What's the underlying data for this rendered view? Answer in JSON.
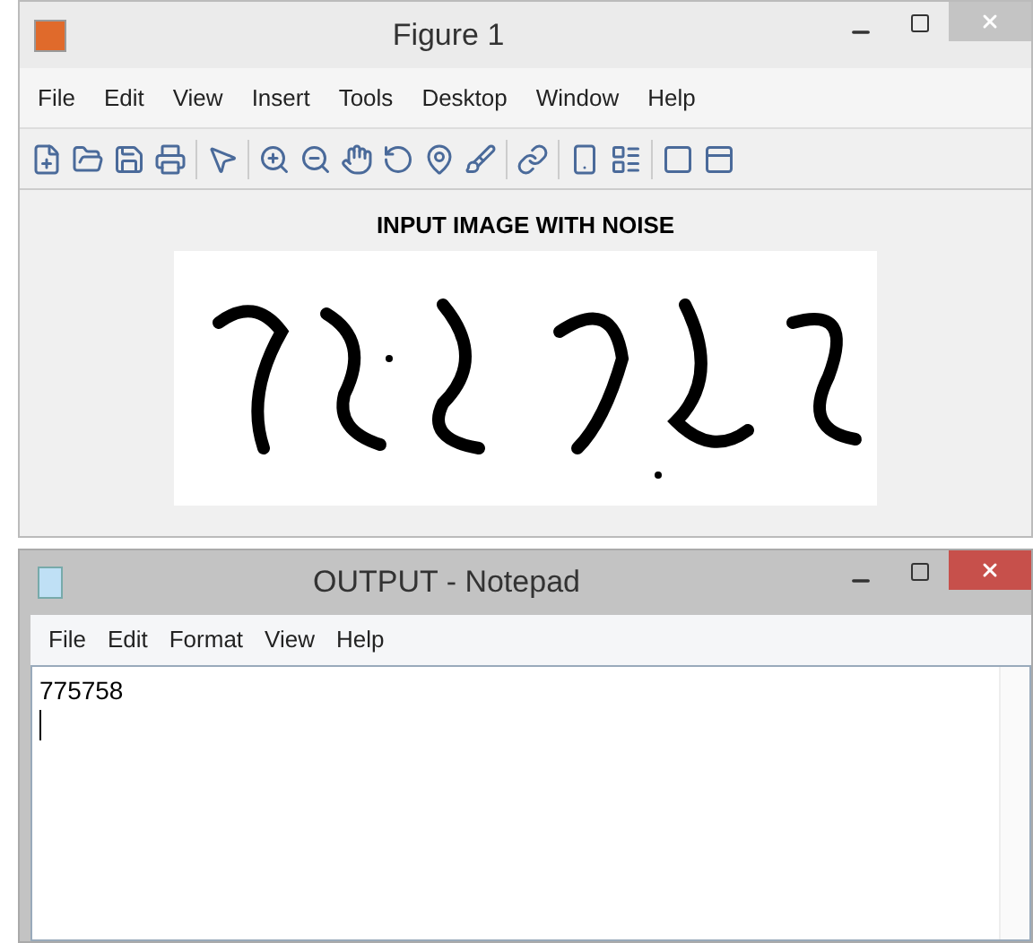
{
  "figure_window": {
    "title": "Figure 1",
    "active": false,
    "menu": [
      "File",
      "Edit",
      "View",
      "Insert",
      "Tools",
      "Desktop",
      "Window",
      "Help"
    ],
    "axes_title": "INPUT IMAGE WITH NOISE"
  },
  "notepad_window": {
    "title": "OUTPUT - Notepad",
    "active": true,
    "menu": [
      "File",
      "Edit",
      "Format",
      "View",
      "Help"
    ],
    "text": "775758"
  }
}
